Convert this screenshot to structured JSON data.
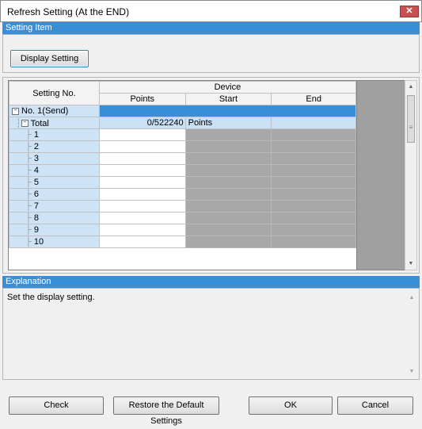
{
  "window": {
    "title": "Refresh Setting (At the END)",
    "close_icon": "close-icon"
  },
  "setting_item": {
    "header": "Setting Item",
    "display_setting_label": "Display Setting"
  },
  "table": {
    "col_setting_no": "Setting No.",
    "col_device": "Device",
    "col_points": "Points",
    "col_start": "Start",
    "col_end": "End",
    "group_label": "No. 1(Send)",
    "total_label": "Total",
    "total_points": "0/522240",
    "total_unit": "Points",
    "rows": [
      "1",
      "2",
      "3",
      "4",
      "5",
      "6",
      "7",
      "8",
      "9",
      "10"
    ]
  },
  "explanation": {
    "header": "Explanation",
    "text": "Set the display setting."
  },
  "buttons": {
    "check": "Check",
    "restore": "Restore the Default Settings",
    "ok": "OK",
    "cancel": "Cancel"
  },
  "colors": {
    "header_blue": "#3a8ed8",
    "close_red": "#c75050"
  }
}
